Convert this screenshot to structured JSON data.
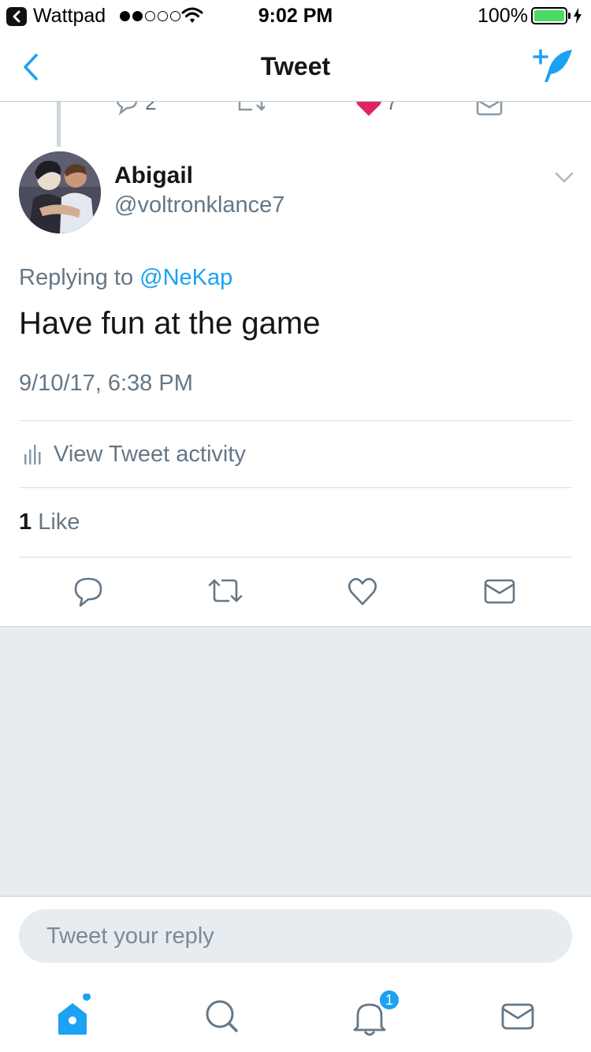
{
  "status_bar": {
    "back_app": "Wattpad",
    "time": "9:02 PM",
    "battery_percent": "100%",
    "signal_bars_filled": 2,
    "signal_bars_total": 5
  },
  "nav": {
    "title": "Tweet",
    "back_icon": "chevron-left-icon",
    "compose_icon": "compose-tweet-icon",
    "accent_color": "#1da1f2"
  },
  "previous_tweet": {
    "reply_count": "2",
    "like_count": "7",
    "liked": true
  },
  "tweet": {
    "author_name": "Abigail",
    "author_handle": "@voltronklance7",
    "replying_prefix": "Replying to",
    "replying_to": "@NeKap",
    "text": "Have fun at the game",
    "timestamp": "9/10/17, 6:38 PM",
    "activity_label": "View Tweet activity",
    "like_count": "1",
    "like_label": "Like"
  },
  "actions": [
    "reply-icon",
    "retweet-icon",
    "like-icon",
    "direct-message-icon"
  ],
  "reply": {
    "placeholder": "Tweet your reply"
  },
  "tabbar": {
    "items": [
      "home-icon",
      "search-icon",
      "notifications-icon",
      "messages-icon"
    ],
    "notification_badge": "1"
  }
}
